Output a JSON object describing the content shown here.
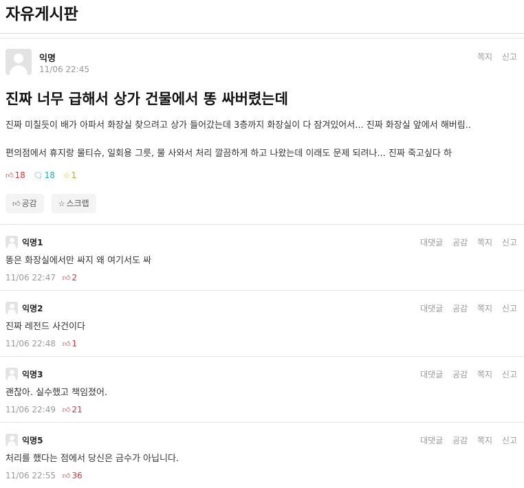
{
  "board": {
    "title": "자유게시판"
  },
  "post": {
    "author": "익명",
    "time": "11/06 22:45",
    "actions": {
      "message": "쪽지",
      "report": "신고"
    },
    "title": "진짜 너무 급해서 상가 건물에서 똥 싸버렸는데",
    "body": [
      "진짜 미칠듯이 배가 아파서 화장실 찾으려고 상가 들어갔는데 3층까지 화장실이 다 잠겨있어서... 진짜 화장실 앞에서 해버림..",
      "편의점에서 휴지랑 물티슈, 일회용 그릇, 물 사와서 처리 깔끔하게 하고 나왔는데 이래도 문제 되려나... 진짜 죽고싶다 하"
    ],
    "stats": {
      "likes": "18",
      "comments": "18",
      "scraps": "1"
    },
    "buttons": {
      "like": "공감",
      "scrap": "스크랩"
    }
  },
  "comment_actions": {
    "reply": "대댓글",
    "like": "공감",
    "message": "쪽지",
    "report": "신고"
  },
  "comments": [
    {
      "author": "익명1",
      "text": "똥은 화장실에서만 싸지 왜 여기서도 싸",
      "time": "11/06 22:47",
      "likes": "2"
    },
    {
      "author": "익명2",
      "text": "진짜 레전드 사건이다",
      "time": "11/06 22:48",
      "likes": "1"
    },
    {
      "author": "익명3",
      "text": "괜찮아. 실수했고 책임졌어.",
      "time": "11/06 22:49",
      "likes": "21"
    },
    {
      "author": "익명5",
      "text": "처리를 했다는 점에서 당신은 금수가 아닙니다.",
      "time": "11/06 22:55",
      "likes": "36"
    }
  ],
  "icons": {
    "like": "thumbs-up-icon",
    "comment": "speech-bubble-icon",
    "scrap": "star-icon",
    "avatar": "default-avatar-icon"
  },
  "colors": {
    "like": "#dd3333",
    "comment": "#2aa9b2",
    "scrap": "#d4a900",
    "muted": "#999999"
  }
}
